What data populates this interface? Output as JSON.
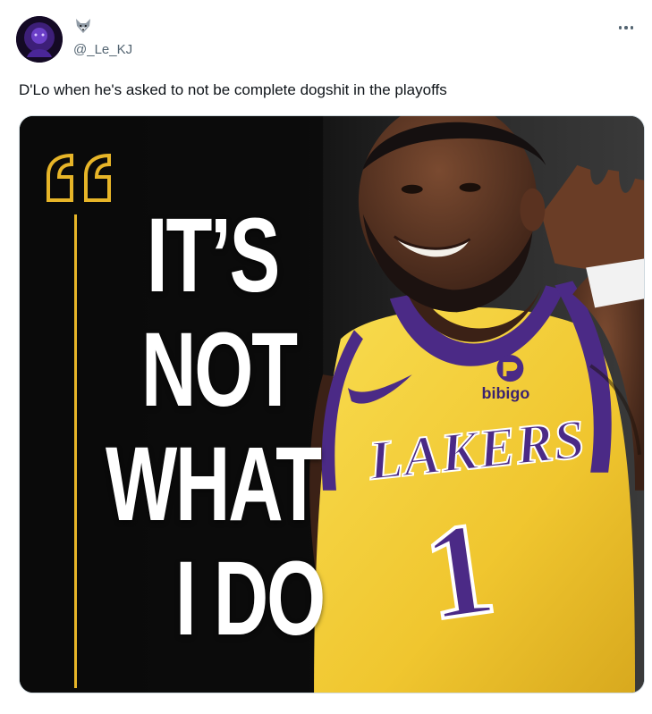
{
  "author": {
    "name_emoji": "fox-face-emoji",
    "handle": "@_Le_KJ",
    "avatar": "avatar-icon"
  },
  "tweet": {
    "text": "D'Lo when he's asked to not be complete dogshit in the playoffs"
  },
  "media": {
    "quote_lines": [
      "IT’S",
      "NOT",
      "WHAT",
      "I DO"
    ],
    "jersey": {
      "team": "LAKERS",
      "number": "1",
      "sponsor": "bibigo"
    },
    "colors": {
      "quote_accent": "#e7b528",
      "jersey_gold": "#f5cf38",
      "jersey_purple": "#4b2a86"
    }
  },
  "icons": {
    "more": "more-icon"
  }
}
